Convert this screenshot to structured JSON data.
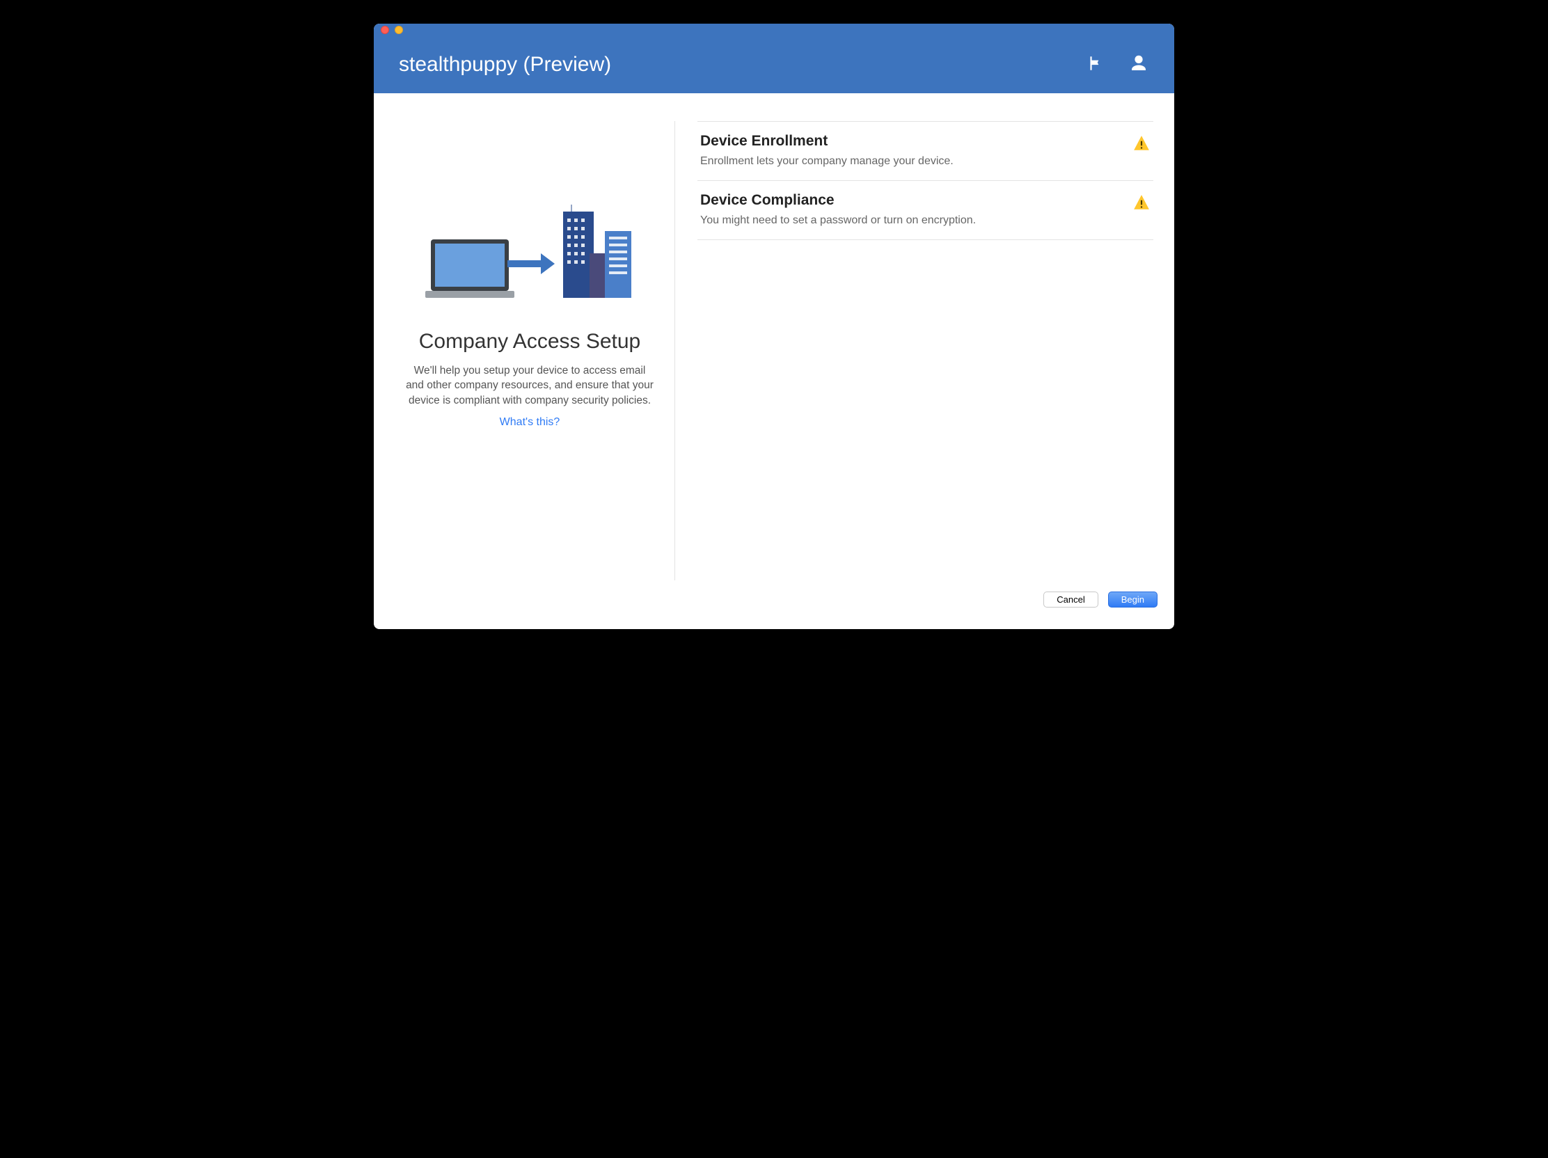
{
  "header": {
    "title": "stealthpuppy (Preview)"
  },
  "left": {
    "heading": "Company Access Setup",
    "description": "We'll help you setup your device to access email and other company resources, and ensure that your device is compliant with company security policies.",
    "help_link": "What's this?"
  },
  "items": [
    {
      "title": "Device Enrollment",
      "subtitle": "Enrollment lets your company manage your device.",
      "status": "warning"
    },
    {
      "title": "Device Compliance",
      "subtitle": "You might need to set a password or turn on encryption.",
      "status": "warning"
    }
  ],
  "footer": {
    "cancel": "Cancel",
    "begin": "Begin"
  },
  "colors": {
    "header_bg": "#3d74be",
    "link": "#2f7bf5",
    "warning": "#ffc62c"
  }
}
